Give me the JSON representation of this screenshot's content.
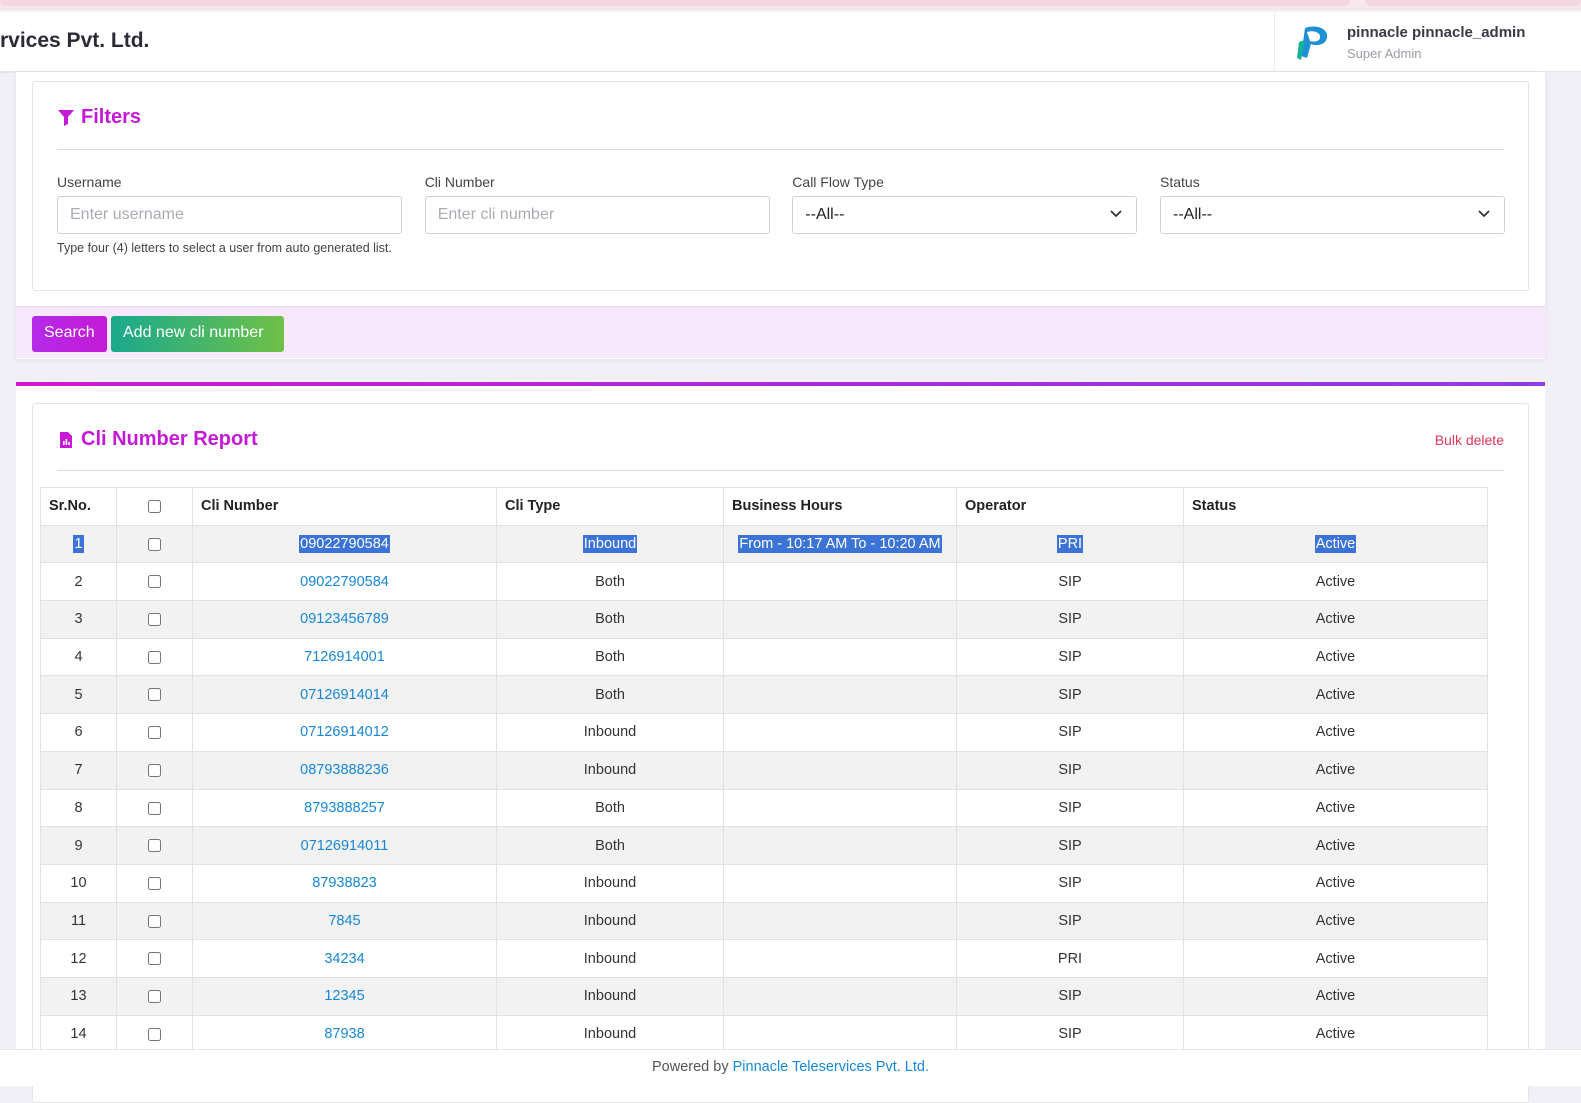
{
  "header": {
    "brand": "rvices Pvt. Ltd.",
    "user_name": "pinnacle pinnacle_admin",
    "user_role": "Super Admin"
  },
  "filters": {
    "title": "Filters",
    "username": {
      "label": "Username",
      "placeholder": "Enter username",
      "hint": "Type four (4) letters to select a user from auto generated list."
    },
    "cli_number": {
      "label": "Cli Number",
      "placeholder": "Enter cli number"
    },
    "call_flow_type": {
      "label": "Call Flow Type",
      "value": "--All--"
    },
    "status": {
      "label": "Status",
      "value": "--All--"
    },
    "search_label": "Search",
    "add_label": "Add new cli number"
  },
  "report": {
    "title": "Cli Number Report",
    "bulk_delete": "Bulk delete",
    "columns": [
      "Sr.No.",
      "",
      "Cli Number",
      "Cli Type",
      "Business Hours",
      "Operator",
      "Status"
    ],
    "rows": [
      {
        "sr": "1",
        "cli": "09022790584",
        "type": "Inbound",
        "hours": "From - 10:17 AM To - 10:20 AM",
        "operator": "PRI",
        "status": "Active"
      },
      {
        "sr": "2",
        "cli": "09022790584",
        "type": "Both",
        "hours": "",
        "operator": "SIP",
        "status": "Active"
      },
      {
        "sr": "3",
        "cli": "09123456789",
        "type": "Both",
        "hours": "",
        "operator": "SIP",
        "status": "Active"
      },
      {
        "sr": "4",
        "cli": "7126914001",
        "type": "Both",
        "hours": "",
        "operator": "SIP",
        "status": "Active"
      },
      {
        "sr": "5",
        "cli": "07126914014",
        "type": "Both",
        "hours": "",
        "operator": "SIP",
        "status": "Active"
      },
      {
        "sr": "6",
        "cli": "07126914012",
        "type": "Inbound",
        "hours": "",
        "operator": "SIP",
        "status": "Active"
      },
      {
        "sr": "7",
        "cli": "08793888236",
        "type": "Inbound",
        "hours": "",
        "operator": "SIP",
        "status": "Active"
      },
      {
        "sr": "8",
        "cli": "8793888257",
        "type": "Both",
        "hours": "",
        "operator": "SIP",
        "status": "Active"
      },
      {
        "sr": "9",
        "cli": "07126914011",
        "type": "Both",
        "hours": "",
        "operator": "SIP",
        "status": "Active"
      },
      {
        "sr": "10",
        "cli": "87938823",
        "type": "Inbound",
        "hours": "",
        "operator": "SIP",
        "status": "Active"
      },
      {
        "sr": "11",
        "cli": "7845",
        "type": "Inbound",
        "hours": "",
        "operator": "SIP",
        "status": "Active"
      },
      {
        "sr": "12",
        "cli": "34234",
        "type": "Inbound",
        "hours": "",
        "operator": "PRI",
        "status": "Active"
      },
      {
        "sr": "13",
        "cli": "12345",
        "type": "Inbound",
        "hours": "",
        "operator": "SIP",
        "status": "Active"
      },
      {
        "sr": "14",
        "cli": "87938",
        "type": "Inbound",
        "hours": "",
        "operator": "SIP",
        "status": "Active"
      }
    ]
  },
  "footer": {
    "prefix": "Powered by ",
    "link": "Pinnacle Teleservices Pvt. Ltd."
  },
  "colors": {
    "accent": "#c41ad6",
    "link": "#1787d6",
    "danger": "#e0355c",
    "add_button": "#1aa98e"
  },
  "icons": {
    "filters": "funnel-icon",
    "report": "report-file-icon",
    "logo": "pinnacle-logo"
  }
}
